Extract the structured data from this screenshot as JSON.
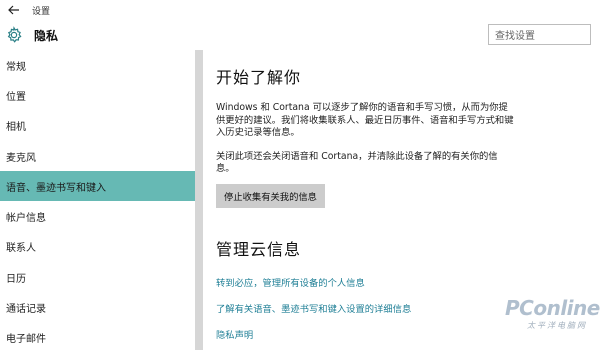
{
  "titlebar": {
    "back_icon": "back-arrow-icon",
    "title": "设置"
  },
  "header": {
    "icon": "gear-icon",
    "section_title": "隐私",
    "search_placeholder": "查找设置"
  },
  "sidebar": {
    "items": [
      {
        "label": "常规"
      },
      {
        "label": "位置"
      },
      {
        "label": "相机"
      },
      {
        "label": "麦克风"
      },
      {
        "label": "语音、墨迹书写和键入",
        "active": true
      },
      {
        "label": "帐户信息"
      },
      {
        "label": "联系人"
      },
      {
        "label": "日历"
      },
      {
        "label": "通话记录"
      },
      {
        "label": "电子邮件"
      }
    ],
    "active_color": "#66b9b4"
  },
  "main": {
    "heading": "开始了解你",
    "description": "Windows 和 Cortana 可以逐步了解你的语音和手写习惯，从而为你提供更好的建议。我们将收集联系人、最近日历事件、语音和手写方式和键入历史记录等信息。",
    "note": "关闭此项还会关闭语音和 Cortana，并清除此设备了解的有关你的信息。",
    "stop_button": "停止收集有关我的信息",
    "cloud_heading": "管理云信息",
    "links": [
      "转到必应，管理所有设备的个人信息",
      "了解有关语音、墨迹书写和键入设置的详细信息",
      "隐私声明"
    ],
    "link_color": "#1f7f96"
  },
  "watermark": {
    "main": "PConline",
    "sub": "太平洋电脑网"
  }
}
